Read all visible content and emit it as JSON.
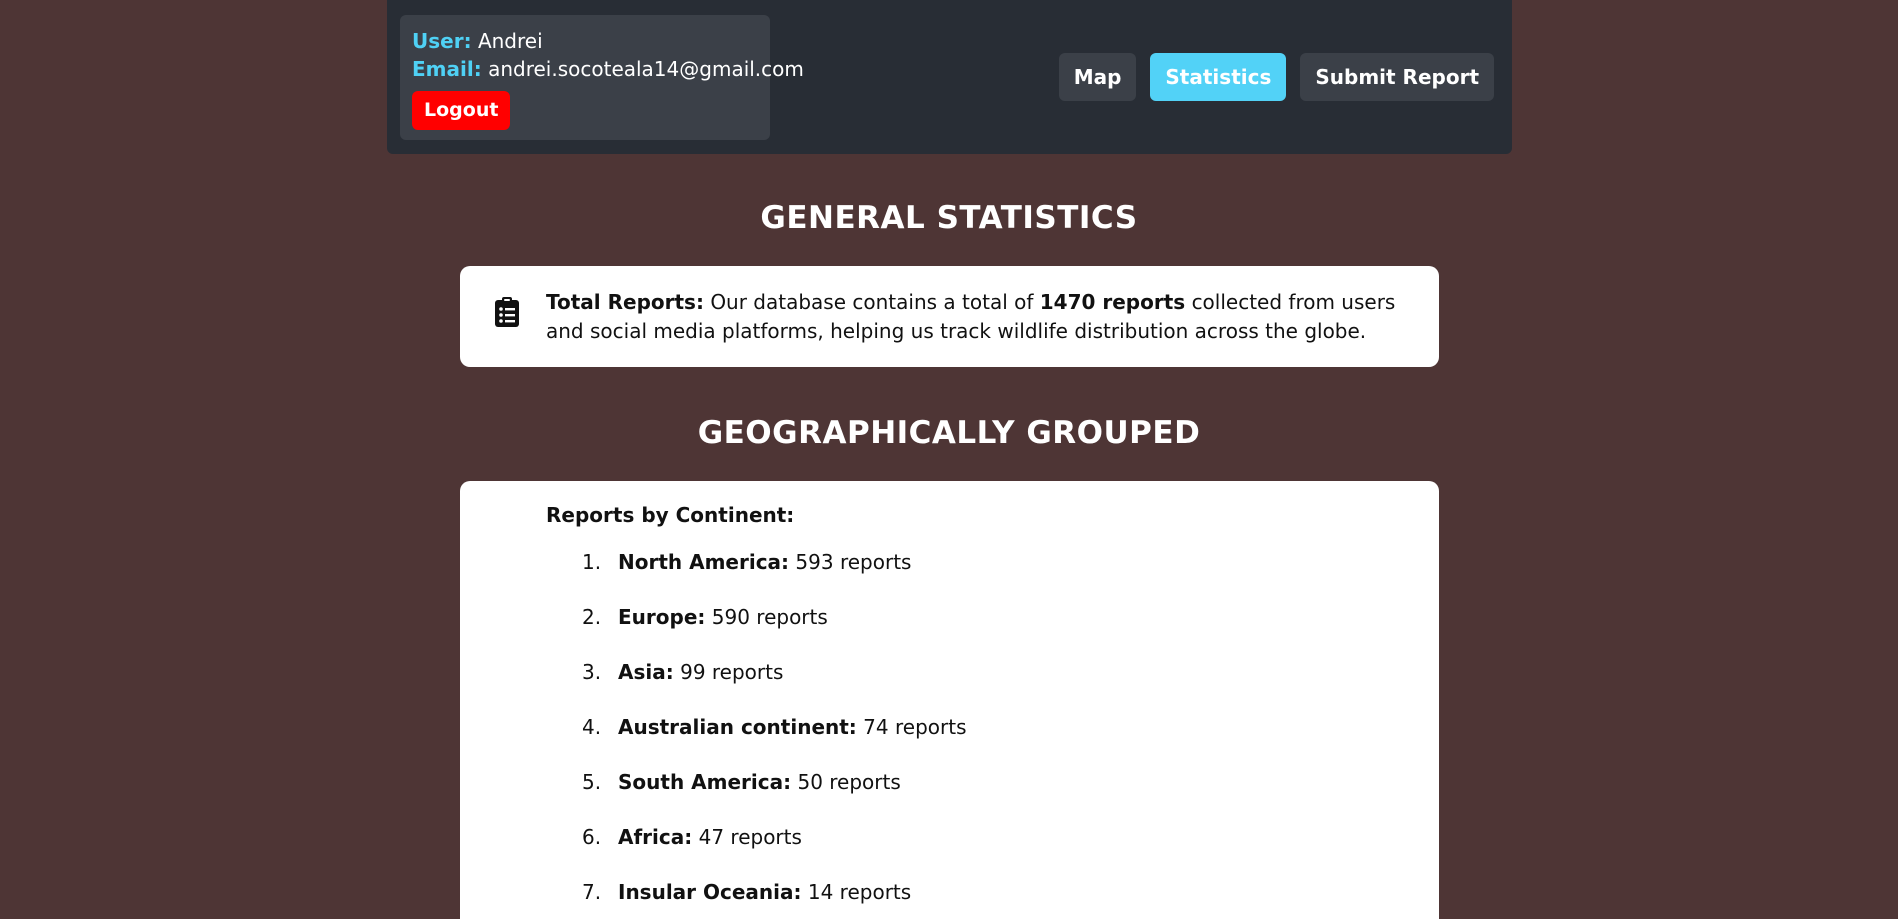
{
  "header": {
    "user_label": "User:",
    "user_name": "Andrei",
    "email_label": "Email:",
    "email_value": "andrei.socoteala14@gmail.com",
    "logout_label": "Logout",
    "nav": {
      "map": "Map",
      "statistics": "Statistics",
      "submit_report": "Submit Report"
    },
    "active_nav": "statistics"
  },
  "general": {
    "title": "GENERAL STATISTICS",
    "icon": "clipboard-list-icon",
    "total_label": "Total Reports:",
    "text_before": "Our database contains a total of",
    "total_count": "1470 reports",
    "text_after": "collected from users and social media platforms, helping us track wildlife distribution across the globe."
  },
  "geo": {
    "title": "GEOGRAPHICALLY GROUPED",
    "list_title": "Reports by Continent:",
    "continents": [
      {
        "num": "1.",
        "name": "North America:",
        "count": "593 reports"
      },
      {
        "num": "2.",
        "name": "Europe:",
        "count": "590 reports"
      },
      {
        "num": "3.",
        "name": "Asia:",
        "count": "99 reports"
      },
      {
        "num": "4.",
        "name": "Australian continent:",
        "count": "74 reports"
      },
      {
        "num": "5.",
        "name": "South America:",
        "count": "50 reports"
      },
      {
        "num": "6.",
        "name": "Africa:",
        "count": "47 reports"
      },
      {
        "num": "7.",
        "name": "Insular Oceania:",
        "count": "14 reports"
      }
    ]
  },
  "colors": {
    "background": "#4e3535",
    "header_bg": "#282d35",
    "accent": "#52d2f7",
    "logout": "#ff0000"
  }
}
